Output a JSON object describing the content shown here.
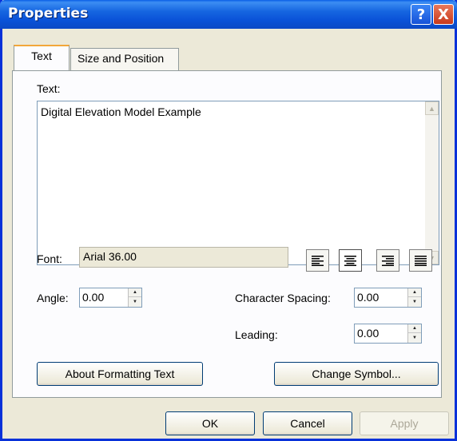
{
  "window": {
    "title": "Properties",
    "help_glyph": "?",
    "close_glyph": "X"
  },
  "tabs": [
    {
      "label": "Text",
      "active": true
    },
    {
      "label": "Size and Position",
      "active": false
    }
  ],
  "text_section": {
    "label": "Text:",
    "value": "Digital Elevation Model Example"
  },
  "font": {
    "label": "Font:",
    "value": "Arial 36.00"
  },
  "alignment": {
    "buttons": [
      {
        "icon": "align-left-icon",
        "selected": false
      },
      {
        "icon": "align-center-icon",
        "selected": true
      },
      {
        "icon": "align-right-icon",
        "selected": false
      },
      {
        "icon": "align-justify-icon",
        "selected": false
      }
    ]
  },
  "angle": {
    "label": "Angle:",
    "value": "0.00"
  },
  "character_spacing": {
    "label": "Character Spacing:",
    "value": "0.00"
  },
  "leading": {
    "label": "Leading:",
    "value": "0.00"
  },
  "buttons": {
    "about_formatting": "About Formatting Text",
    "change_symbol": "Change Symbol...",
    "ok": "OK",
    "cancel": "Cancel",
    "apply": "Apply"
  }
}
